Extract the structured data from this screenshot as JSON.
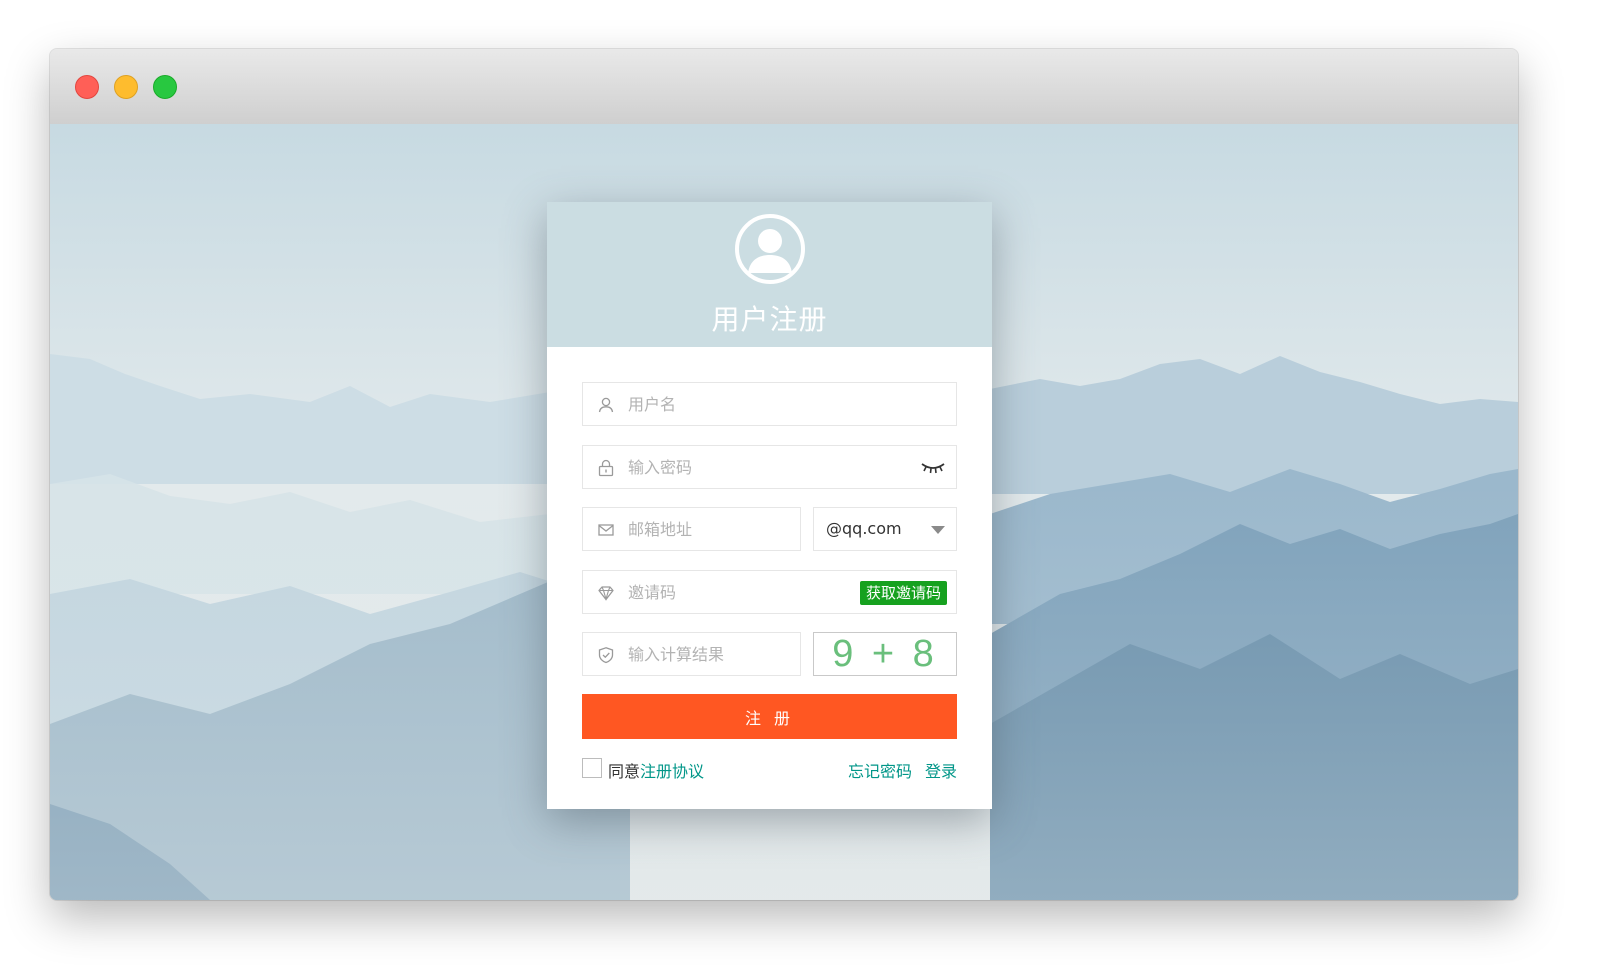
{
  "card": {
    "title": "用户注册",
    "username_placeholder": "用户名",
    "password_placeholder": "输入密码",
    "email_placeholder": "邮箱地址",
    "email_domain": "@qq.com",
    "invite_placeholder": "邀请码",
    "get_invite_label": "获取邀请码",
    "captcha_placeholder": "输入计算结果",
    "captcha_text": "9 + 8",
    "submit_label": "注 册",
    "agree_prefix": "同意",
    "agree_link": "注册协议",
    "forgot_label": "忘记密码",
    "login_label": "登录"
  },
  "icons": {
    "avatar": "user-avatar-icon",
    "username": "user-icon",
    "password": "lock-icon",
    "eye": "eye-closed-icon",
    "email": "envelope-icon",
    "domain_caret": "caret-down-icon",
    "invite": "diamond-icon",
    "captcha": "shield-icon"
  },
  "colors": {
    "submit": "#ff5722",
    "invite_button": "#16a11f",
    "link": "#009688",
    "captcha_text": "#6abf7c"
  }
}
